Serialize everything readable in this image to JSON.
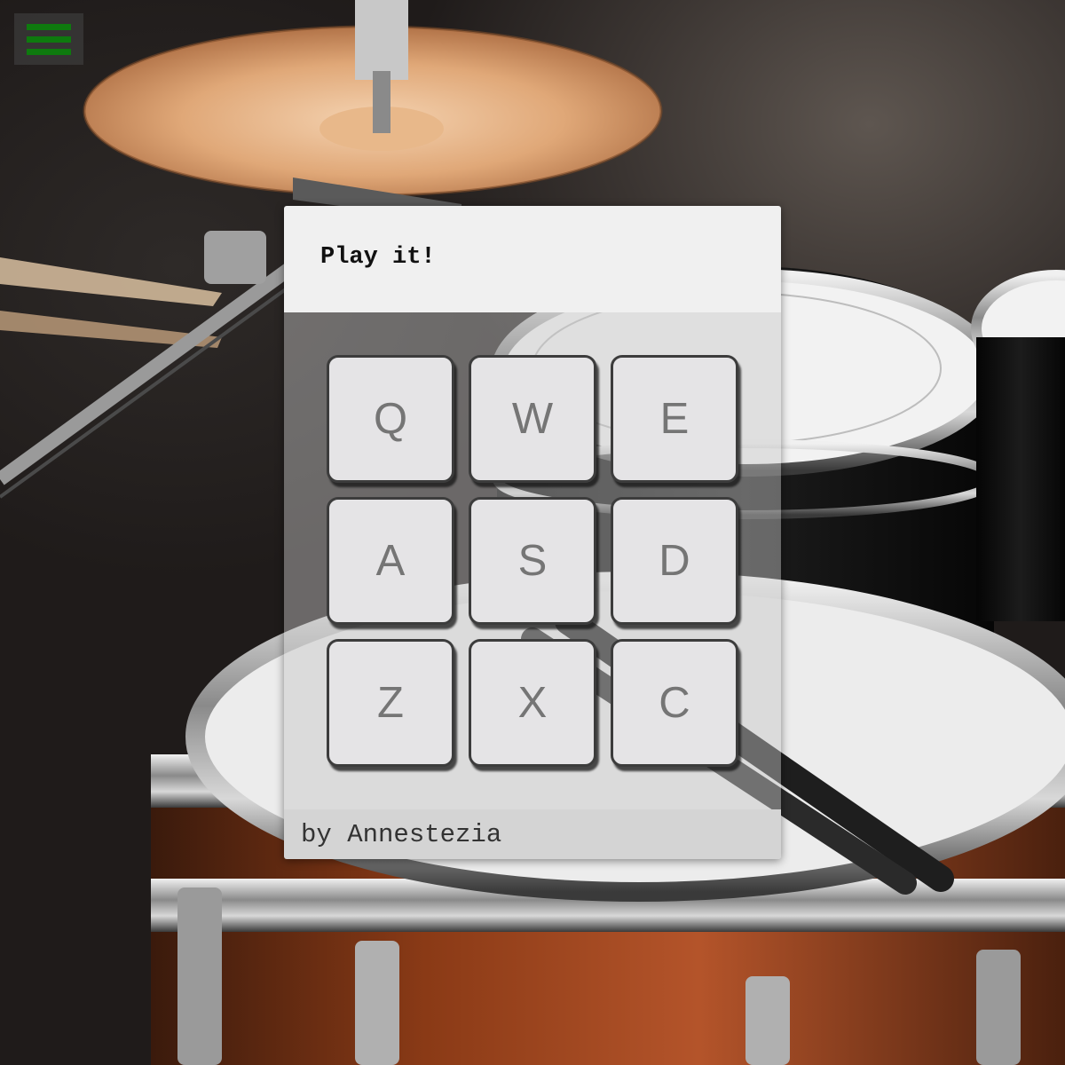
{
  "menu": {
    "icon": "hamburger-menu-icon",
    "color": "#0e7a0e"
  },
  "card": {
    "title": "Play it!",
    "footer": "by Annestezia"
  },
  "pads": [
    {
      "key": "Q"
    },
    {
      "key": "W"
    },
    {
      "key": "E"
    },
    {
      "key": "A"
    },
    {
      "key": "S"
    },
    {
      "key": "D"
    },
    {
      "key": "Z"
    },
    {
      "key": "X"
    },
    {
      "key": "C"
    }
  ]
}
